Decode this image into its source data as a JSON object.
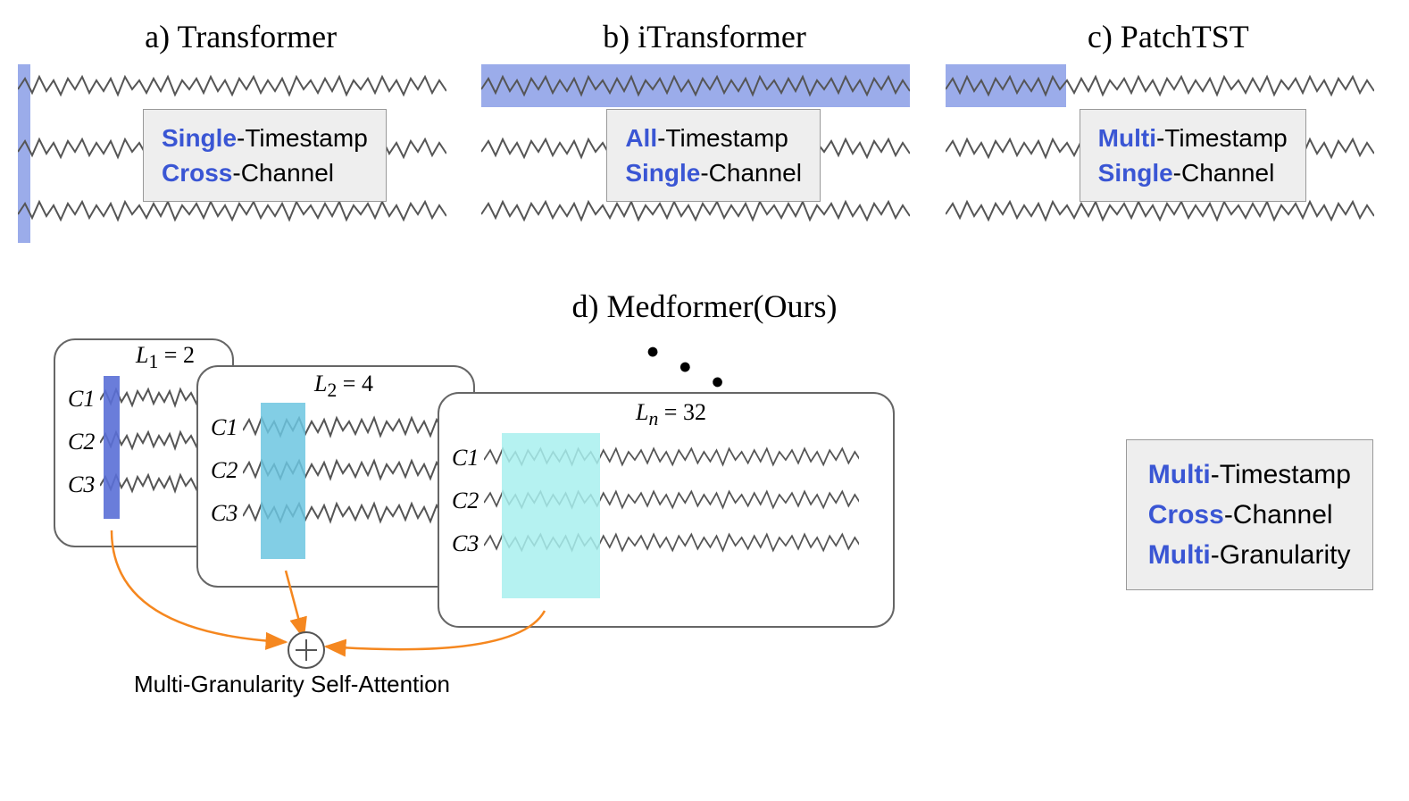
{
  "panels": {
    "a": {
      "title": "a) Transformer",
      "line1_kw": "Single",
      "line1_rest": "-Timestamp",
      "line2_kw": "Cross",
      "line2_rest": "-Channel"
    },
    "b": {
      "title": "b) iTransformer",
      "line1_kw": "All",
      "line1_rest": "-Timestamp",
      "line2_kw": "Single",
      "line2_rest": "-Channel"
    },
    "c": {
      "title": "c) PatchTST",
      "line1_kw": "Multi",
      "line1_rest": "-Timestamp",
      "line2_kw": "Single",
      "line2_rest": "-Channel"
    },
    "d": {
      "title": "d) Medformer(Ours)",
      "line1_kw": "Multi",
      "line1_rest": "-Timestamp",
      "line2_kw": "Cross",
      "line2_rest": "-Channel",
      "line3_kw": "Multi",
      "line3_rest": "-Granularity"
    }
  },
  "cards": {
    "L1": "L₁ = 2",
    "L2": "L₂ = 4",
    "Ln": "Lₙ = 32",
    "C1": "C1",
    "C2": "C2",
    "C3": "C3"
  },
  "attention_label": "Multi-Granularity Self-Attention",
  "dots": "• • •"
}
